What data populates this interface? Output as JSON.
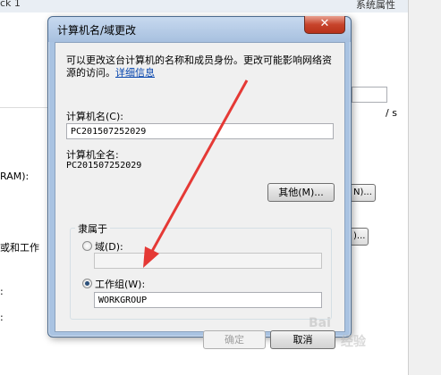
{
  "background": {
    "title_fragment_left": "ck 1",
    "title_fragment_right": "系统属性",
    "text_slash_s": "/ s",
    "text_ram": "RAM):",
    "text_domain_workgroup": "或和工作",
    "text_colon1": ":",
    "text_colon2": ":",
    "btn_n_label": "N)...",
    "btn_c_label": ")..."
  },
  "dialog": {
    "title": "计算机名/域更改",
    "close_glyph": "✕",
    "description": "可以更改这台计算机的名称和成员身份。更改可能影响网络资源的访问。",
    "details_link": "详细信息",
    "computer_name_label": "计算机名(C):",
    "computer_name_value": "PC201507252029",
    "full_name_label": "计算机全名:",
    "full_name_value": "PC201507252029",
    "more_button": "其他(M)...",
    "member_of_label": "隶属于",
    "domain_label": "域(D):",
    "domain_value": "",
    "workgroup_label": "工作组(W):",
    "workgroup_value": "WORKGROUP",
    "ok_button": "确定",
    "cancel_button": "取消"
  },
  "watermark": {
    "line1": "Bai",
    "line2": "经验"
  },
  "colors": {
    "dialog_frame": "#a9c3e2",
    "client_bg": "#f0f0f0",
    "link": "#0645ad",
    "arrow": "#e53935",
    "close_button": "#c7432b"
  }
}
